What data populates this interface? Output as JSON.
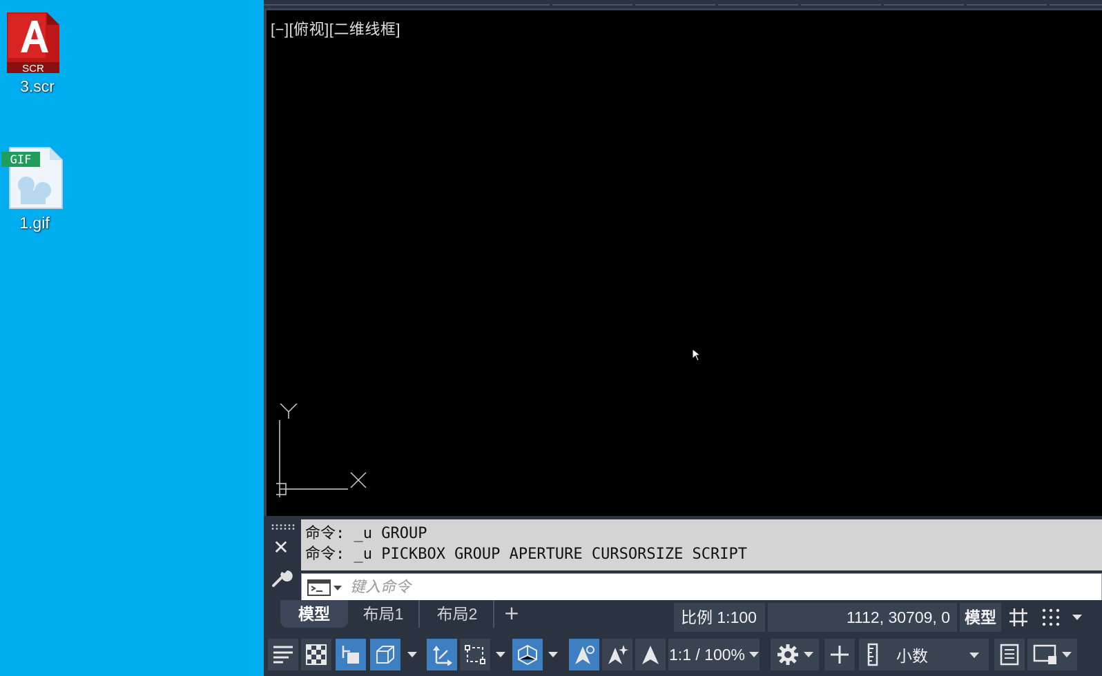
{
  "desktop": {
    "icons": [
      {
        "label": "3.scr",
        "badge": "SCR"
      },
      {
        "label": "1.gif",
        "badge": "GIF"
      }
    ],
    "background": "#00adef"
  },
  "autocad": {
    "viewport_label": "[−][俯视][二维线框]",
    "ucs": {
      "x_label": "X",
      "y_label": "Y"
    },
    "command_history": [
      "命令: _u GROUP",
      "命令: _u PICKBOX GROUP APERTURE CURSORSIZE SCRIPT"
    ],
    "command_input": {
      "placeholder": "键入命令",
      "value": ""
    },
    "layout_tabs": [
      {
        "label": "模型",
        "active": true
      },
      {
        "label": "布局1",
        "active": false
      },
      {
        "label": "布局2",
        "active": false
      }
    ],
    "add_tab_label": "+",
    "status": {
      "scale": "比例 1:100",
      "coordinates": "1112, 30709, 0",
      "model_button": "模型"
    },
    "toolbar": {
      "annotation_scale": "1:1 / 100%",
      "units": "小数"
    },
    "accent_color": "#3e7fc1",
    "viewport_background": "#000000"
  }
}
